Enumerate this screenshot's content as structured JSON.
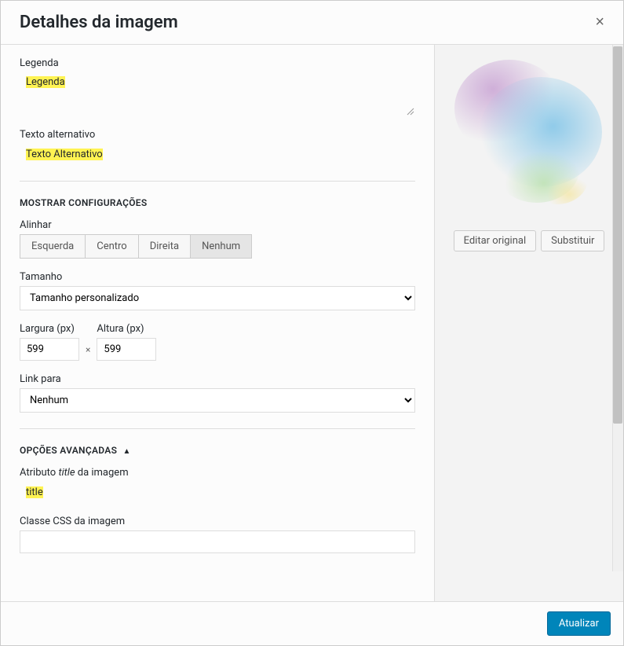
{
  "header": {
    "title": "Detalhes da imagem",
    "close": "×"
  },
  "fields": {
    "legenda_label": "Legenda",
    "legenda_value": "Legenda",
    "alttext_label": "Texto alternativo",
    "alttext_value": "Texto Alternativo",
    "title_attr_label_pre": "Atributo ",
    "title_attr_label_italic": "title",
    "title_attr_label_post": " da imagem",
    "title_attr_value": "title",
    "css_class_label": "Classe CSS da imagem"
  },
  "display_settings": {
    "section_label": "MOSTRAR CONFIGURAÇÕES",
    "align_label": "Alinhar",
    "align_options": {
      "left": "Esquerda",
      "center": "Centro",
      "right": "Direita",
      "none": "Nenhum"
    },
    "size_label": "Tamanho",
    "size_value": "Tamanho personalizado",
    "width_label": "Largura (px)",
    "width_value": "599",
    "height_label": "Altura (px)",
    "height_value": "599",
    "dim_sep": "×",
    "link_label": "Link para",
    "link_value": "Nenhum"
  },
  "advanced": {
    "section_label": "OPÇÕES AVANÇADAS",
    "arrow": "▲"
  },
  "right": {
    "edit_original": "Editar original",
    "replace": "Substituir"
  },
  "footer": {
    "update": "Atualizar"
  }
}
